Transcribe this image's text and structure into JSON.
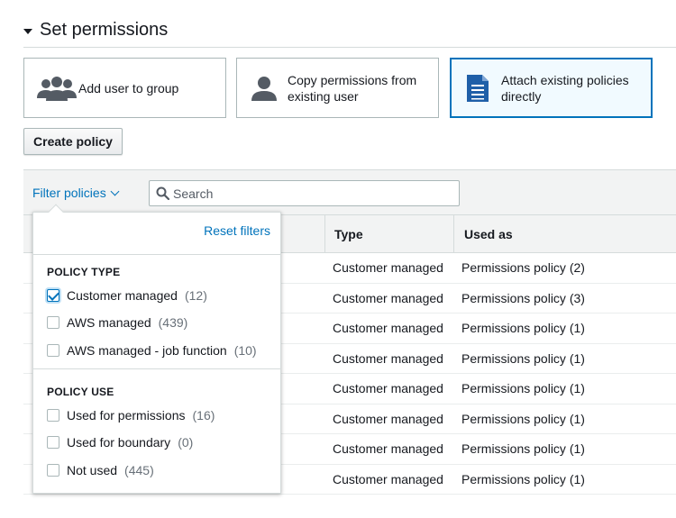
{
  "section": {
    "title": "Set permissions"
  },
  "options": [
    {
      "label": "Add user to group",
      "icon": "user-group-icon",
      "selected": false
    },
    {
      "label": "Copy permissions from existing user",
      "icon": "user-icon",
      "selected": false
    },
    {
      "label": "Attach existing policies directly",
      "icon": "document-icon",
      "selected": true
    }
  ],
  "actions": {
    "create_policy": "Create policy"
  },
  "toolbar": {
    "filter_label": "Filter policies",
    "search_placeholder": "Search"
  },
  "table": {
    "columns": [
      "Type",
      "Used as"
    ],
    "rows": [
      {
        "type": "Customer managed",
        "used_as": "Permissions policy (2)"
      },
      {
        "type": "Customer managed",
        "used_as": "Permissions policy (3)"
      },
      {
        "type": "Customer managed",
        "used_as": "Permissions policy (1)"
      },
      {
        "type": "Customer managed",
        "used_as": "Permissions policy (1)"
      },
      {
        "type": "Customer managed",
        "used_as": "Permissions policy (1)"
      },
      {
        "type": "Customer managed",
        "used_as": "Permissions policy (1)"
      },
      {
        "type": "Customer managed",
        "used_as": "Permissions policy (1)"
      },
      {
        "type": "Customer managed",
        "used_as": "Permissions policy (1)"
      }
    ]
  },
  "filter_popover": {
    "reset_label": "Reset filters",
    "policy_type": {
      "title": "POLICY TYPE",
      "options": [
        {
          "label": "Customer managed",
          "count": "(12)",
          "checked": true
        },
        {
          "label": "AWS managed",
          "count": "(439)",
          "checked": false
        },
        {
          "label": "AWS managed - job function",
          "count": "(10)",
          "checked": false
        }
      ]
    },
    "policy_use": {
      "title": "POLICY USE",
      "options": [
        {
          "label": "Used for permissions",
          "count": "(16)",
          "checked": false
        },
        {
          "label": "Used for boundary",
          "count": "(0)",
          "checked": false
        },
        {
          "label": "Not used",
          "count": "(445)",
          "checked": false
        }
      ]
    }
  },
  "colors": {
    "accent": "#0073bb",
    "border": "#aab7b8",
    "header_bg": "#f2f3f3",
    "icon": "#545b64"
  }
}
